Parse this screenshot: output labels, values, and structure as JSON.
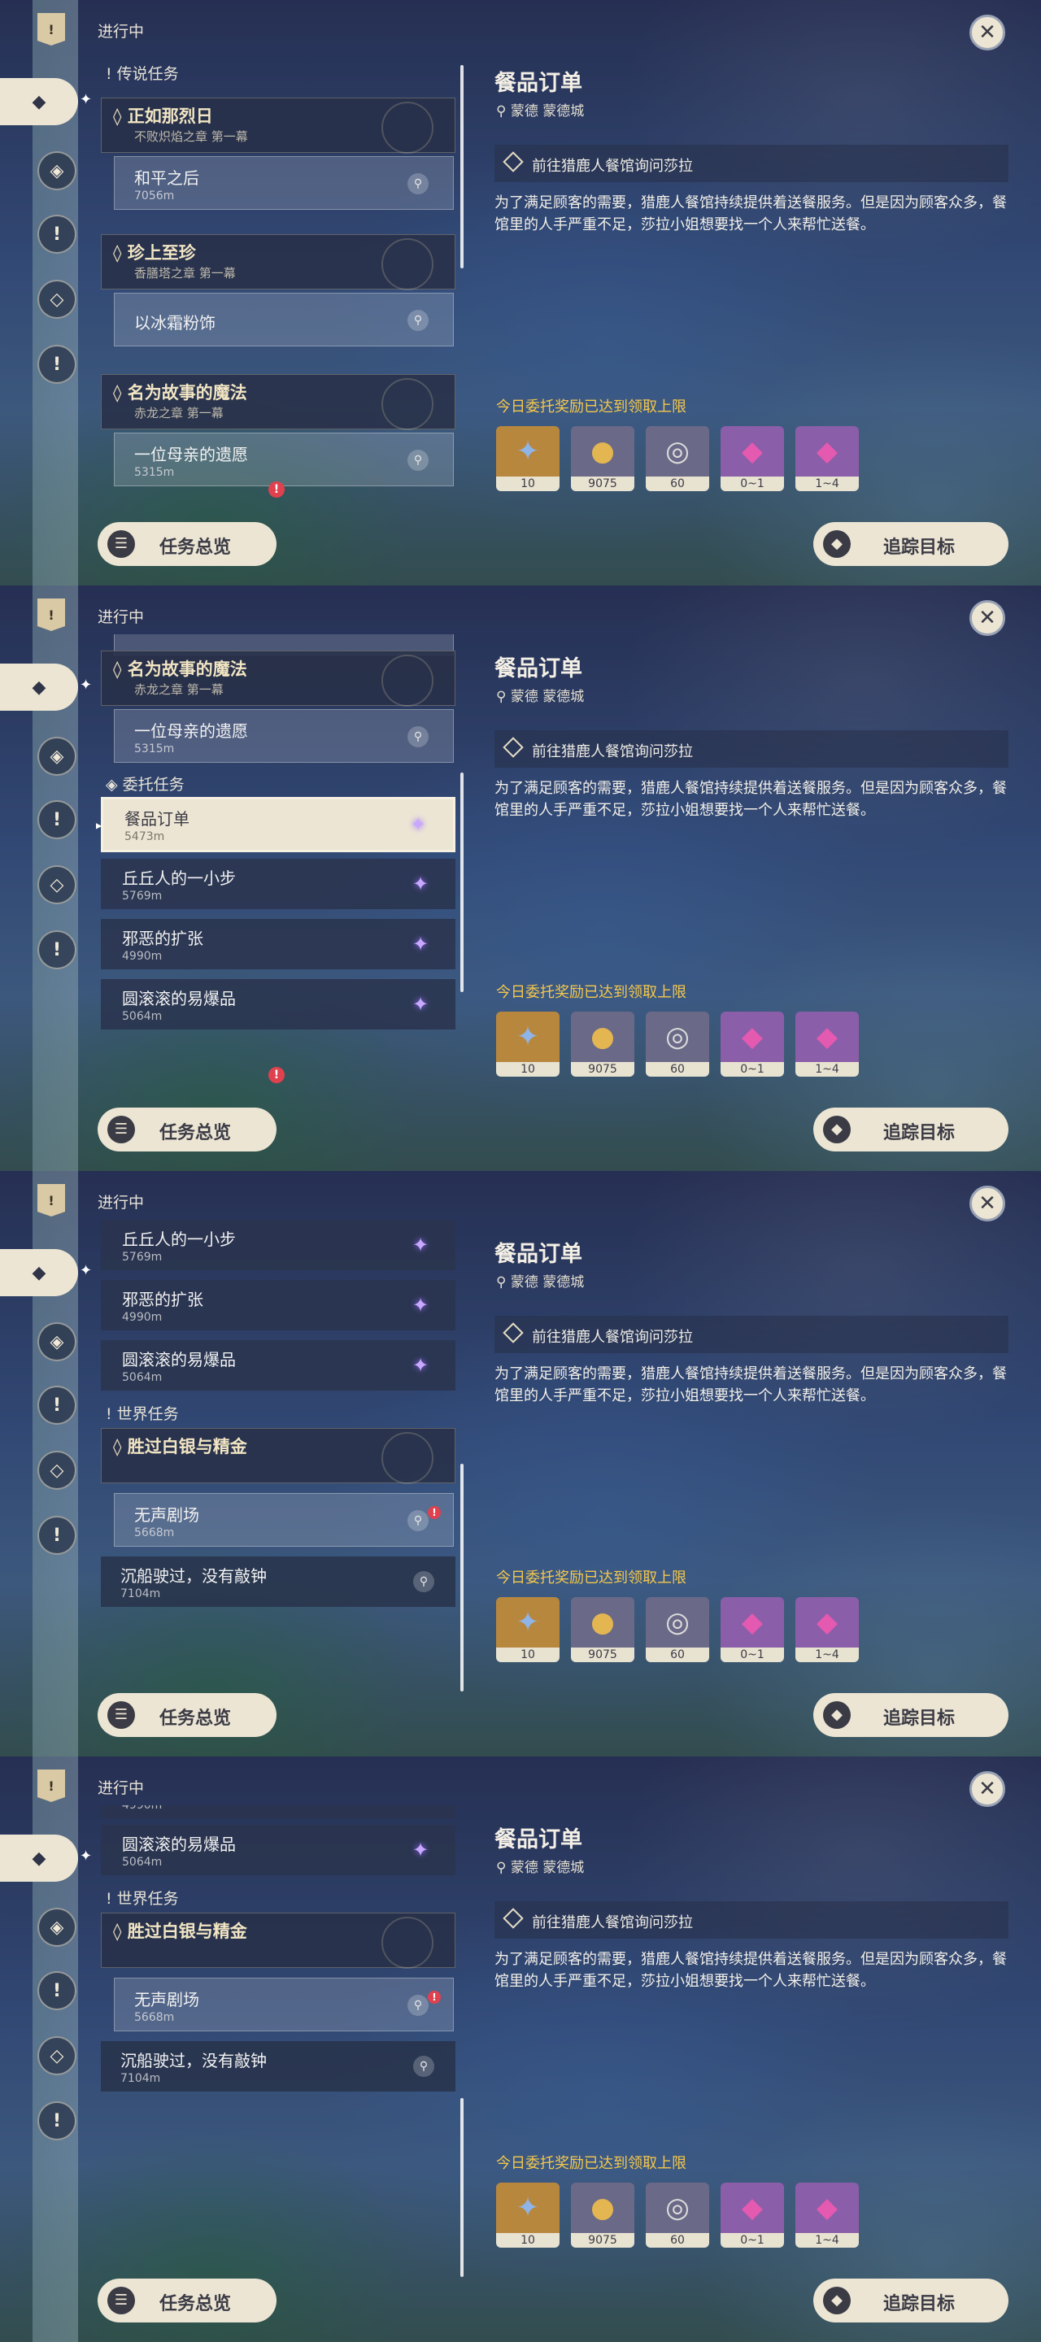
{
  "ui": {
    "header": "进行中",
    "close_icon": "✕",
    "overview_label": "任务总览",
    "track_label": "追踪目标",
    "rail_icons": [
      "quest-book",
      "legend",
      "archon",
      "exclamation",
      "commission",
      "exclamation"
    ]
  },
  "detail": {
    "title": "餐品订单",
    "location": "蒙德 蒙德城",
    "step": "前往猎鹿人餐馆询问莎拉",
    "description": "为了满足顾客的需要，猎鹿人餐馆持续提供着送餐服务。但是因为顾客众多，餐馆里的人手严重不足，莎拉小姐想要找一个人来帮忙送餐。",
    "reward_note": "今日委托奖励已达到领取上限",
    "rewards": [
      {
        "name": "adventure-exp",
        "qty": "10",
        "color": "#b8873e",
        "glyph": "✦"
      },
      {
        "name": "mora",
        "qty": "9075",
        "color": "#6a6a88",
        "glyph": "●"
      },
      {
        "name": "companionship-exp",
        "qty": "60",
        "color": "#6a6a88",
        "glyph": "◎"
      },
      {
        "name": "crystal-chunk",
        "qty": "0~1",
        "color": "#8a5ea8",
        "glyph": "◆"
      },
      {
        "name": "crystal-chunk-2",
        "qty": "1~4",
        "color": "#8a5ea8",
        "glyph": "◆"
      }
    ]
  },
  "sections": {
    "legend": "传说任务",
    "commission": "委托任务",
    "world": "世界任务"
  },
  "quests": {
    "q1": {
      "title": "正如那烈日",
      "chapter": "不败炽焰之章 第一幕",
      "step": "和平之后",
      "dist": "7056m"
    },
    "q2": {
      "title": "珍上至珍",
      "chapter": "香膳塔之章 第一幕",
      "step": "以冰霜粉饰"
    },
    "q3": {
      "title": "名为故事的魔法",
      "chapter": "赤龙之章 第一幕",
      "step": "一位母亲的遗愿",
      "dist": "5315m"
    },
    "c1": {
      "title": "餐品订单",
      "dist": "5473m"
    },
    "c2": {
      "title": "丘丘人的一小步",
      "dist": "5769m"
    },
    "c3": {
      "title": "邪恶的扩张",
      "dist": "4990m"
    },
    "c4": {
      "title": "圆滚滚的易爆品",
      "dist": "5064m"
    },
    "w1": {
      "title": "胜过白银与精金",
      "step": "无声剧场",
      "dist": "5668m"
    },
    "w2": {
      "title": "沉船驶过，没有敲钟",
      "dist": "7104m"
    }
  }
}
